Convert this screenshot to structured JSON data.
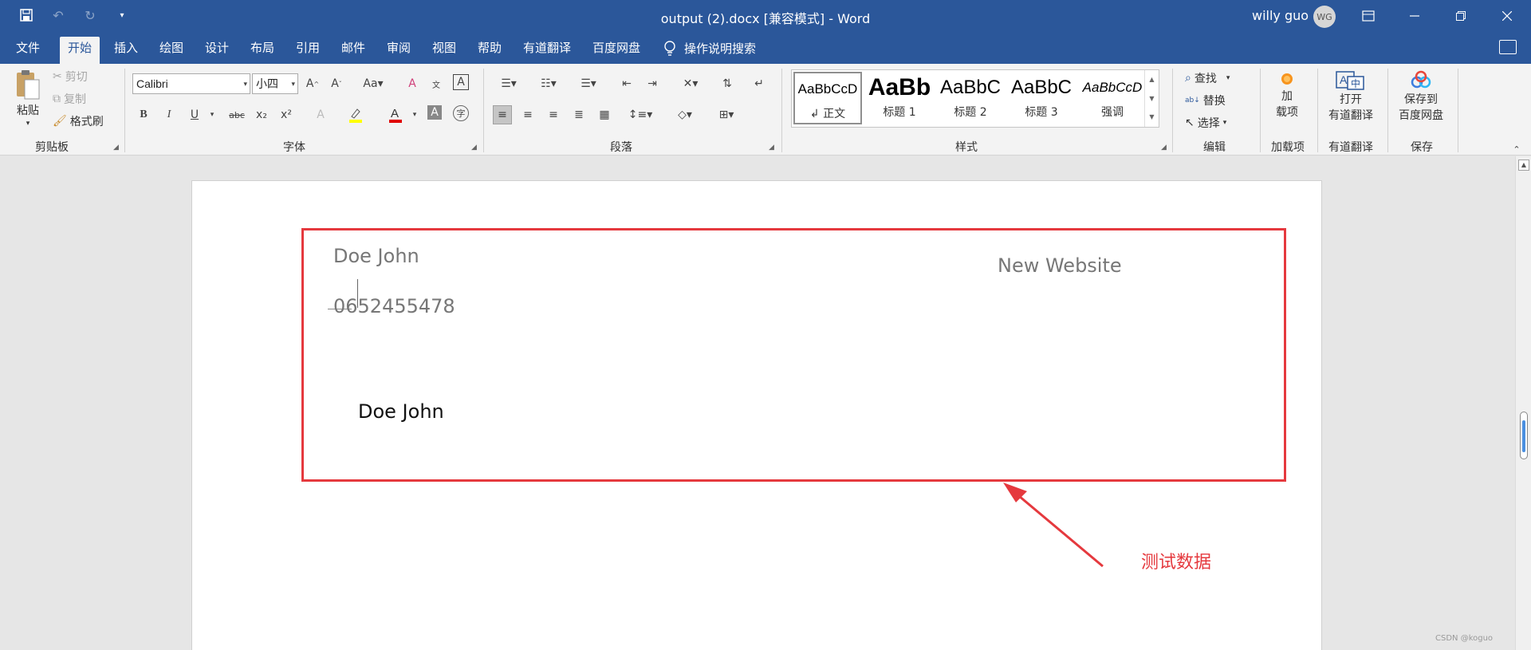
{
  "titlebar": {
    "doc_title": "output (2).docx [兼容模式]  -  Word",
    "user_name": "willy guo",
    "avatar_initials": "WG"
  },
  "tabs": [
    "文件",
    "开始",
    "插入",
    "绘图",
    "设计",
    "布局",
    "引用",
    "邮件",
    "审阅",
    "视图",
    "帮助",
    "有道翻译",
    "百度网盘"
  ],
  "active_tab": "开始",
  "tell_me": "操作说明搜索",
  "clipboard": {
    "paste": "粘贴",
    "cut": "剪切",
    "copy": "复制",
    "format_painter": "格式刷",
    "label": "剪贴板"
  },
  "font": {
    "name": "Calibri",
    "size": "小四",
    "label": "字体",
    "buttons": [
      "B",
      "I",
      "U",
      "abc",
      "x₂",
      "x²"
    ]
  },
  "paragraph": {
    "label": "段落"
  },
  "styles": {
    "label": "样式",
    "items": [
      {
        "sample": "AaBbCcD",
        "name": "↲ 正文"
      },
      {
        "sample": "AaBb",
        "name": "标题 1"
      },
      {
        "sample": "AaBbC",
        "name": "标题 2"
      },
      {
        "sample": "AaBbC",
        "name": "标题 3"
      },
      {
        "sample": "AaBbCcD",
        "name": "强调"
      }
    ]
  },
  "editing": {
    "label": "编辑",
    "find": "查找",
    "replace": "替换",
    "select": "选择"
  },
  "addins": {
    "line1": "加",
    "line2": "载项",
    "label": "加载项"
  },
  "youdao": {
    "line1": "打开",
    "line2": "有道翻译",
    "label": "有道翻译"
  },
  "baidu": {
    "line1": "保存到",
    "line2": "百度网盘",
    "label": "保存"
  },
  "document": {
    "name_top": "Doe John",
    "website": "New Website",
    "phone": "0652455478",
    "name_bottom": "Doe John"
  },
  "annotation": "测试数据",
  "watermark": "CSDN @koguo",
  "colors": {
    "word_blue": "#2b579a",
    "highlight_red": "#e5393e",
    "font_color_red": "#e00000",
    "highlight_yellow": "#ffff00"
  }
}
